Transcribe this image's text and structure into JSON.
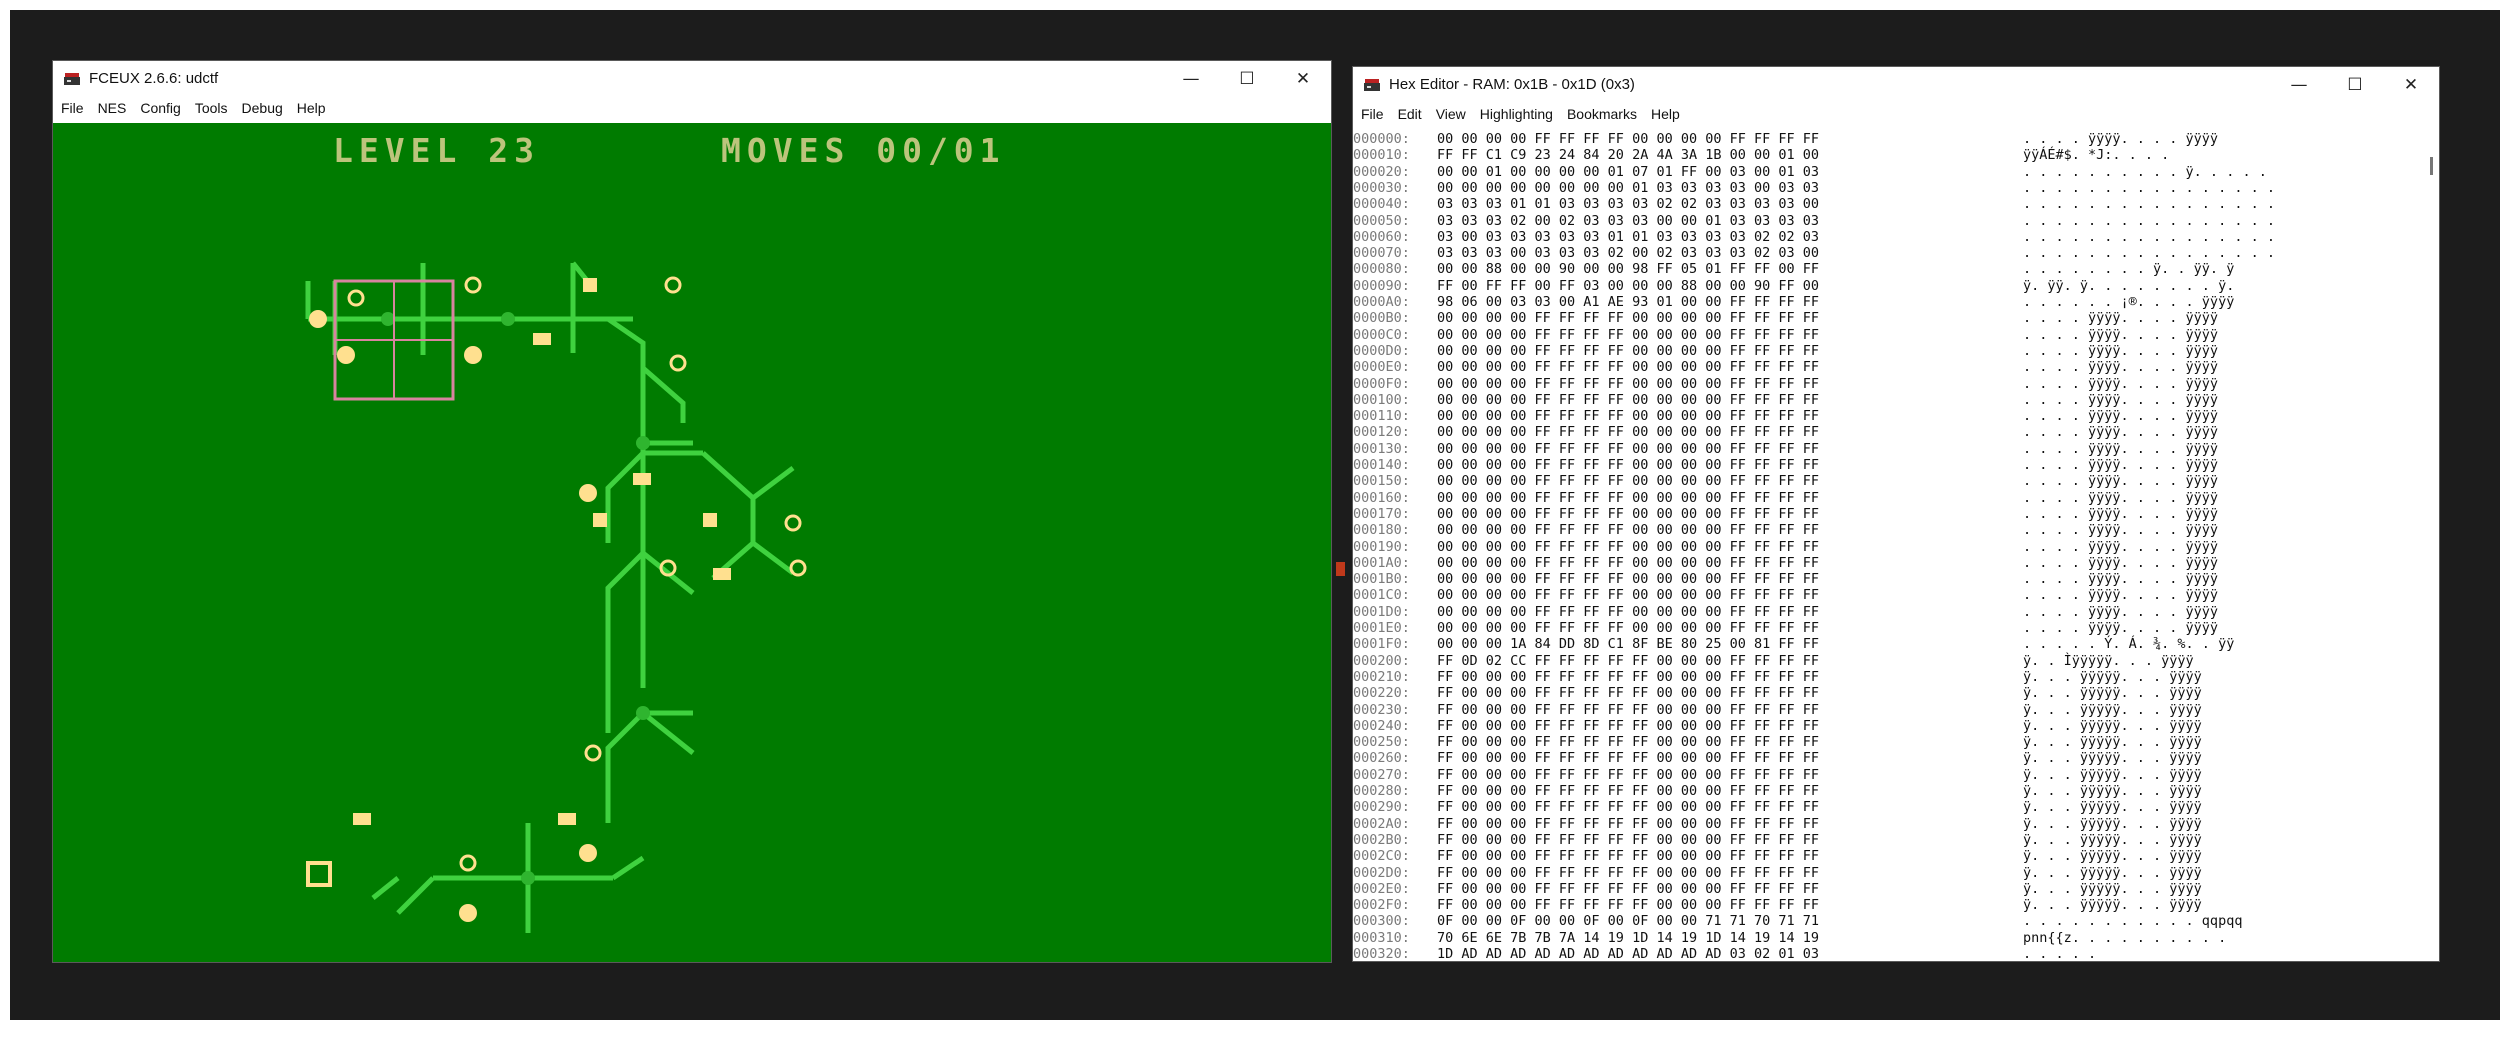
{
  "emulator": {
    "title": "FCEUX 2.6.6: udctf",
    "menu": [
      "File",
      "NES",
      "Config",
      "Tools",
      "Debug",
      "Help"
    ],
    "hud": {
      "level": "LEVEL 23",
      "moves": "MOVES 00/01"
    },
    "colors": {
      "background": "#007b00",
      "circuit": "#3fd23f",
      "node": "#ffe08f",
      "cursor": "#d8849f"
    }
  },
  "hex_editor": {
    "title": "Hex Editor - RAM: 0x1B - 0x1D (0x3)",
    "menu": [
      "File",
      "Edit",
      "View",
      "Highlighting",
      "Bookmarks",
      "Help"
    ],
    "rows": [
      {
        "addr": "000000:",
        "bytes": "00 00 00 00 FF FF FF FF 00 00 00 00 FF FF FF FF",
        "ascii": ". . . . ÿÿÿÿ. . . . ÿÿÿÿ"
      },
      {
        "addr": "000010:",
        "bytes": "FF FF C1 C9 23 24 84 20 2A 4A 3A 1B 00 00 01 00",
        "ascii": "ÿÿÁÉ#$. *J:. . . ."
      },
      {
        "addr": "000020:",
        "bytes": "00 00 01 00 00 00 00 01 07 01 FF 00 03 00 01 03",
        "ascii": ". . . . . . . . . . ÿ. . . . ."
      },
      {
        "addr": "000030:",
        "bytes": "00 00 00 00 00 00 00 00 01 03 03 03 03 00 03 03",
        "ascii": ". . . . . . . . . . . . . . . ."
      },
      {
        "addr": "000040:",
        "bytes": "03 03 03 01 01 03 03 03 03 02 02 03 03 03 03 00",
        "ascii": ". . . . . . . . . . . . . . . ."
      },
      {
        "addr": "000050:",
        "bytes": "03 03 03 02 00 02 03 03 03 00 00 01 03 03 03 03",
        "ascii": ". . . . . . . . . . . . . . . ."
      },
      {
        "addr": "000060:",
        "bytes": "03 00 03 03 03 03 03 01 01 03 03 03 03 02 02 03",
        "ascii": ". . . . . . . . . . . . . . . ."
      },
      {
        "addr": "000070:",
        "bytes": "03 03 03 00 03 03 03 02 00 02 03 03 03 02 03 00",
        "ascii": ". . . . . . . . . . . . . . . ."
      },
      {
        "addr": "000080:",
        "bytes": "00 00 88 00 00 90 00 00 98 FF 05 01 FF FF 00 FF",
        "ascii": ". . . . . . . . ÿ. . ÿÿ. ÿ"
      },
      {
        "addr": "000090:",
        "bytes": "FF 00 FF FF 00 FF 03 00 00 00 88 00 00 90 FF 00",
        "ascii": "ÿ. ÿÿ. ÿ. . . . . . . . ÿ."
      },
      {
        "addr": "0000A0:",
        "bytes": "98 06 00 03 03 00 A1 AE 93 01 00 00 FF FF FF FF",
        "ascii": ". . . . . . ¡®. . . . ÿÿÿÿ"
      },
      {
        "addr": "0000B0:",
        "bytes": "00 00 00 00 FF FF FF FF 00 00 00 00 FF FF FF FF",
        "ascii": ". . . . ÿÿÿÿ. . . . ÿÿÿÿ"
      },
      {
        "addr": "0000C0:",
        "bytes": "00 00 00 00 FF FF FF FF 00 00 00 00 FF FF FF FF",
        "ascii": ". . . . ÿÿÿÿ. . . . ÿÿÿÿ"
      },
      {
        "addr": "0000D0:",
        "bytes": "00 00 00 00 FF FF FF FF 00 00 00 00 FF FF FF FF",
        "ascii": ". . . . ÿÿÿÿ. . . . ÿÿÿÿ"
      },
      {
        "addr": "0000E0:",
        "bytes": "00 00 00 00 FF FF FF FF 00 00 00 00 FF FF FF FF",
        "ascii": ". . . . ÿÿÿÿ. . . . ÿÿÿÿ"
      },
      {
        "addr": "0000F0:",
        "bytes": "00 00 00 00 FF FF FF FF 00 00 00 00 FF FF FF FF",
        "ascii": ". . . . ÿÿÿÿ. . . . ÿÿÿÿ"
      },
      {
        "addr": "000100:",
        "bytes": "00 00 00 00 FF FF FF FF 00 00 00 00 FF FF FF FF",
        "ascii": ". . . . ÿÿÿÿ. . . . ÿÿÿÿ"
      },
      {
        "addr": "000110:",
        "bytes": "00 00 00 00 FF FF FF FF 00 00 00 00 FF FF FF FF",
        "ascii": ". . . . ÿÿÿÿ. . . . ÿÿÿÿ"
      },
      {
        "addr": "000120:",
        "bytes": "00 00 00 00 FF FF FF FF 00 00 00 00 FF FF FF FF",
        "ascii": ". . . . ÿÿÿÿ. . . . ÿÿÿÿ"
      },
      {
        "addr": "000130:",
        "bytes": "00 00 00 00 FF FF FF FF 00 00 00 00 FF FF FF FF",
        "ascii": ". . . . ÿÿÿÿ. . . . ÿÿÿÿ"
      },
      {
        "addr": "000140:",
        "bytes": "00 00 00 00 FF FF FF FF 00 00 00 00 FF FF FF FF",
        "ascii": ". . . . ÿÿÿÿ. . . . ÿÿÿÿ"
      },
      {
        "addr": "000150:",
        "bytes": "00 00 00 00 FF FF FF FF 00 00 00 00 FF FF FF FF",
        "ascii": ". . . . ÿÿÿÿ. . . . ÿÿÿÿ"
      },
      {
        "addr": "000160:",
        "bytes": "00 00 00 00 FF FF FF FF 00 00 00 00 FF FF FF FF",
        "ascii": ". . . . ÿÿÿÿ. . . . ÿÿÿÿ"
      },
      {
        "addr": "000170:",
        "bytes": "00 00 00 00 FF FF FF FF 00 00 00 00 FF FF FF FF",
        "ascii": ". . . . ÿÿÿÿ. . . . ÿÿÿÿ"
      },
      {
        "addr": "000180:",
        "bytes": "00 00 00 00 FF FF FF FF 00 00 00 00 FF FF FF FF",
        "ascii": ". . . . ÿÿÿÿ. . . . ÿÿÿÿ"
      },
      {
        "addr": "000190:",
        "bytes": "00 00 00 00 FF FF FF FF 00 00 00 00 FF FF FF FF",
        "ascii": ". . . . ÿÿÿÿ. . . . ÿÿÿÿ"
      },
      {
        "addr": "0001A0:",
        "bytes": "00 00 00 00 FF FF FF FF 00 00 00 00 FF FF FF FF",
        "ascii": ". . . . ÿÿÿÿ. . . . ÿÿÿÿ"
      },
      {
        "addr": "0001B0:",
        "bytes": "00 00 00 00 FF FF FF FF 00 00 00 00 FF FF FF FF",
        "ascii": ". . . . ÿÿÿÿ. . . . ÿÿÿÿ"
      },
      {
        "addr": "0001C0:",
        "bytes": "00 00 00 00 FF FF FF FF 00 00 00 00 FF FF FF FF",
        "ascii": ". . . . ÿÿÿÿ. . . . ÿÿÿÿ"
      },
      {
        "addr": "0001D0:",
        "bytes": "00 00 00 00 FF FF FF FF 00 00 00 00 FF FF FF FF",
        "ascii": ". . . . ÿÿÿÿ. . . . ÿÿÿÿ"
      },
      {
        "addr": "0001E0:",
        "bytes": "00 00 00 00 FF FF FF FF 00 00 00 00 FF FF FF FF",
        "ascii": ". . . . ÿÿÿÿ. . . . ÿÿÿÿ"
      },
      {
        "addr": "0001F0:",
        "bytes": "00 00 00 1A 84 DD 8D C1 8F BE 80 25 00 81 FF FF",
        "ascii": ". . . . . Ý. Á. ¾. %. . ÿÿ"
      },
      {
        "addr": "000200:",
        "bytes": "FF 0D 02 CC FF FF FF FF FF 00 00 00 FF FF FF FF",
        "ascii": "ÿ. . Ìÿÿÿÿÿ. . . ÿÿÿÿ"
      },
      {
        "addr": "000210:",
        "bytes": "FF 00 00 00 FF FF FF FF FF 00 00 00 FF FF FF FF",
        "ascii": "ÿ. . . ÿÿÿÿÿ. . . ÿÿÿÿ"
      },
      {
        "addr": "000220:",
        "bytes": "FF 00 00 00 FF FF FF FF FF 00 00 00 FF FF FF FF",
        "ascii": "ÿ. . . ÿÿÿÿÿ. . . ÿÿÿÿ"
      },
      {
        "addr": "000230:",
        "bytes": "FF 00 00 00 FF FF FF FF FF 00 00 00 FF FF FF FF",
        "ascii": "ÿ. . . ÿÿÿÿÿ. . . ÿÿÿÿ"
      },
      {
        "addr": "000240:",
        "bytes": "FF 00 00 00 FF FF FF FF FF 00 00 00 FF FF FF FF",
        "ascii": "ÿ. . . ÿÿÿÿÿ. . . ÿÿÿÿ"
      },
      {
        "addr": "000250:",
        "bytes": "FF 00 00 00 FF FF FF FF FF 00 00 00 FF FF FF FF",
        "ascii": "ÿ. . . ÿÿÿÿÿ. . . ÿÿÿÿ"
      },
      {
        "addr": "000260:",
        "bytes": "FF 00 00 00 FF FF FF FF FF 00 00 00 FF FF FF FF",
        "ascii": "ÿ. . . ÿÿÿÿÿ. . . ÿÿÿÿ"
      },
      {
        "addr": "000270:",
        "bytes": "FF 00 00 00 FF FF FF FF FF 00 00 00 FF FF FF FF",
        "ascii": "ÿ. . . ÿÿÿÿÿ. . . ÿÿÿÿ"
      },
      {
        "addr": "000280:",
        "bytes": "FF 00 00 00 FF FF FF FF FF 00 00 00 FF FF FF FF",
        "ascii": "ÿ. . . ÿÿÿÿÿ. . . ÿÿÿÿ"
      },
      {
        "addr": "000290:",
        "bytes": "FF 00 00 00 FF FF FF FF FF 00 00 00 FF FF FF FF",
        "ascii": "ÿ. . . ÿÿÿÿÿ. . . ÿÿÿÿ"
      },
      {
        "addr": "0002A0:",
        "bytes": "FF 00 00 00 FF FF FF FF FF 00 00 00 FF FF FF FF",
        "ascii": "ÿ. . . ÿÿÿÿÿ. . . ÿÿÿÿ"
      },
      {
        "addr": "0002B0:",
        "bytes": "FF 00 00 00 FF FF FF FF FF 00 00 00 FF FF FF FF",
        "ascii": "ÿ. . . ÿÿÿÿÿ. . . ÿÿÿÿ"
      },
      {
        "addr": "0002C0:",
        "bytes": "FF 00 00 00 FF FF FF FF FF 00 00 00 FF FF FF FF",
        "ascii": "ÿ. . . ÿÿÿÿÿ. . . ÿÿÿÿ"
      },
      {
        "addr": "0002D0:",
        "bytes": "FF 00 00 00 FF FF FF FF FF 00 00 00 FF FF FF FF",
        "ascii": "ÿ. . . ÿÿÿÿÿ. . . ÿÿÿÿ"
      },
      {
        "addr": "0002E0:",
        "bytes": "FF 00 00 00 FF FF FF FF FF 00 00 00 FF FF FF FF",
        "ascii": "ÿ. . . ÿÿÿÿÿ. . . ÿÿÿÿ"
      },
      {
        "addr": "0002F0:",
        "bytes": "FF 00 00 00 FF FF FF FF FF 00 00 00 FF FF FF FF",
        "ascii": "ÿ. . . ÿÿÿÿÿ. . . ÿÿÿÿ"
      },
      {
        "addr": "000300:",
        "bytes": "0F 00 00 0F 00 00 0F 00 0F 00 00 71 71 70 71 71",
        "ascii": ". . . . . . . . . . . qqpqq"
      },
      {
        "addr": "000310:",
        "bytes": "70 6E 6E 7B 7B 7A 14 19 1D 14 19 1D 14 19 14 19",
        "ascii": "pnn{{z. . . . . . . . . ."
      },
      {
        "addr": "000320:",
        "bytes": "1D AD AD AD AD AD AD AD AD AD AD AD 03 02 01 03",
        "ascii": ". ­­­­­­­­­­­. . . ."
      }
    ],
    "colors": {
      "highlight": "#111111",
      "modified": "#c07a1a",
      "changed": "#1a9a1a"
    }
  }
}
